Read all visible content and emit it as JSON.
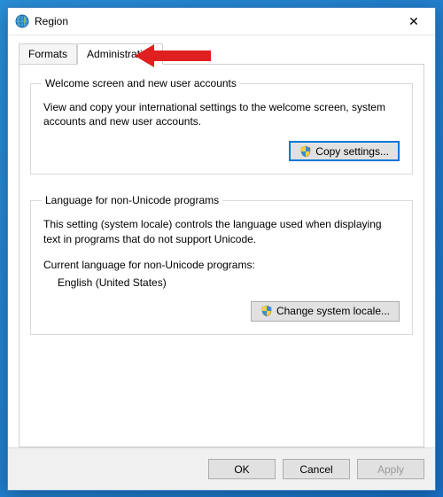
{
  "window": {
    "title": "Region",
    "close_glyph": "✕"
  },
  "tabs": {
    "formats_label": "Formats",
    "administrative_label": "Administrative"
  },
  "group_welcome": {
    "legend": "Welcome screen and new user accounts",
    "text": "View and copy your international settings to the welcome screen, system accounts and new user accounts.",
    "button": "Copy settings..."
  },
  "group_locale": {
    "legend": "Language for non-Unicode programs",
    "text": "This setting (system locale) controls the language used when displaying text in programs that do not support Unicode.",
    "current_label": "Current language for non-Unicode programs:",
    "current_value": "English (United States)",
    "button": "Change system locale..."
  },
  "footer": {
    "ok": "OK",
    "cancel": "Cancel",
    "apply": "Apply"
  }
}
